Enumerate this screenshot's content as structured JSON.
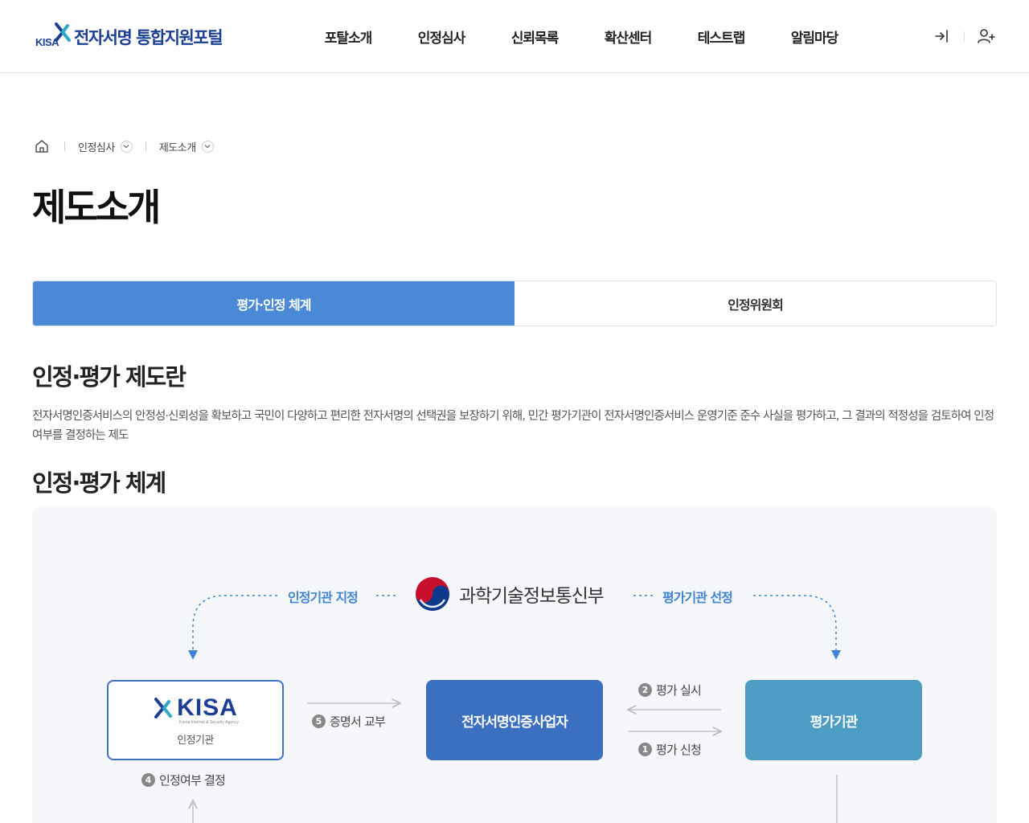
{
  "header": {
    "logo_text": "KISA",
    "site_title": "전자서명 통합지원포털",
    "nav": [
      "포탈소개",
      "인정심사",
      "신뢰목록",
      "확산센터",
      "테스트랩",
      "알림마당"
    ],
    "util_icons": [
      "login-icon",
      "user-add-icon"
    ]
  },
  "breadcrumb": {
    "items": [
      "인정심사",
      "제도소개"
    ]
  },
  "page": {
    "title": "제도소개",
    "tabs": [
      {
        "label": "평가·인정 체계",
        "active": true
      },
      {
        "label": "인정위원회",
        "active": false
      }
    ],
    "section1_title": "인정·평가 제도란",
    "section1_desc": "전자서명인증서비스의 안정성·신뢰성을 확보하고 국민이 다양하고 편리한 전자서명의 선택권을 보장하기 위해, 민간 평가기관이 전자서명인증서비스 운영기준 준수 사실을 평가하고, 그 결과의 적정성을 검토하여 인정 여부를 결정하는 제도",
    "section2_title": "인정·평가 체계"
  },
  "diagram": {
    "ministry": "과학기술정보통신부",
    "label_left": "인정기관 지정",
    "label_right": "평가기관 선정",
    "kisa_logo": "KISA",
    "kisa_logo_sub": "Korea Internet & Security Agency",
    "kisa_label": "인정기관",
    "provider": "전자서명인증사업자",
    "evaluator": "평가기관",
    "steps": {
      "s1": {
        "num": "1",
        "text": "평가 신청"
      },
      "s2": {
        "num": "2",
        "text": "평가 실시"
      },
      "s4": {
        "num": "4",
        "text": "인정여부 결정"
      },
      "s5": {
        "num": "5",
        "text": "증명서 교부"
      }
    }
  }
}
